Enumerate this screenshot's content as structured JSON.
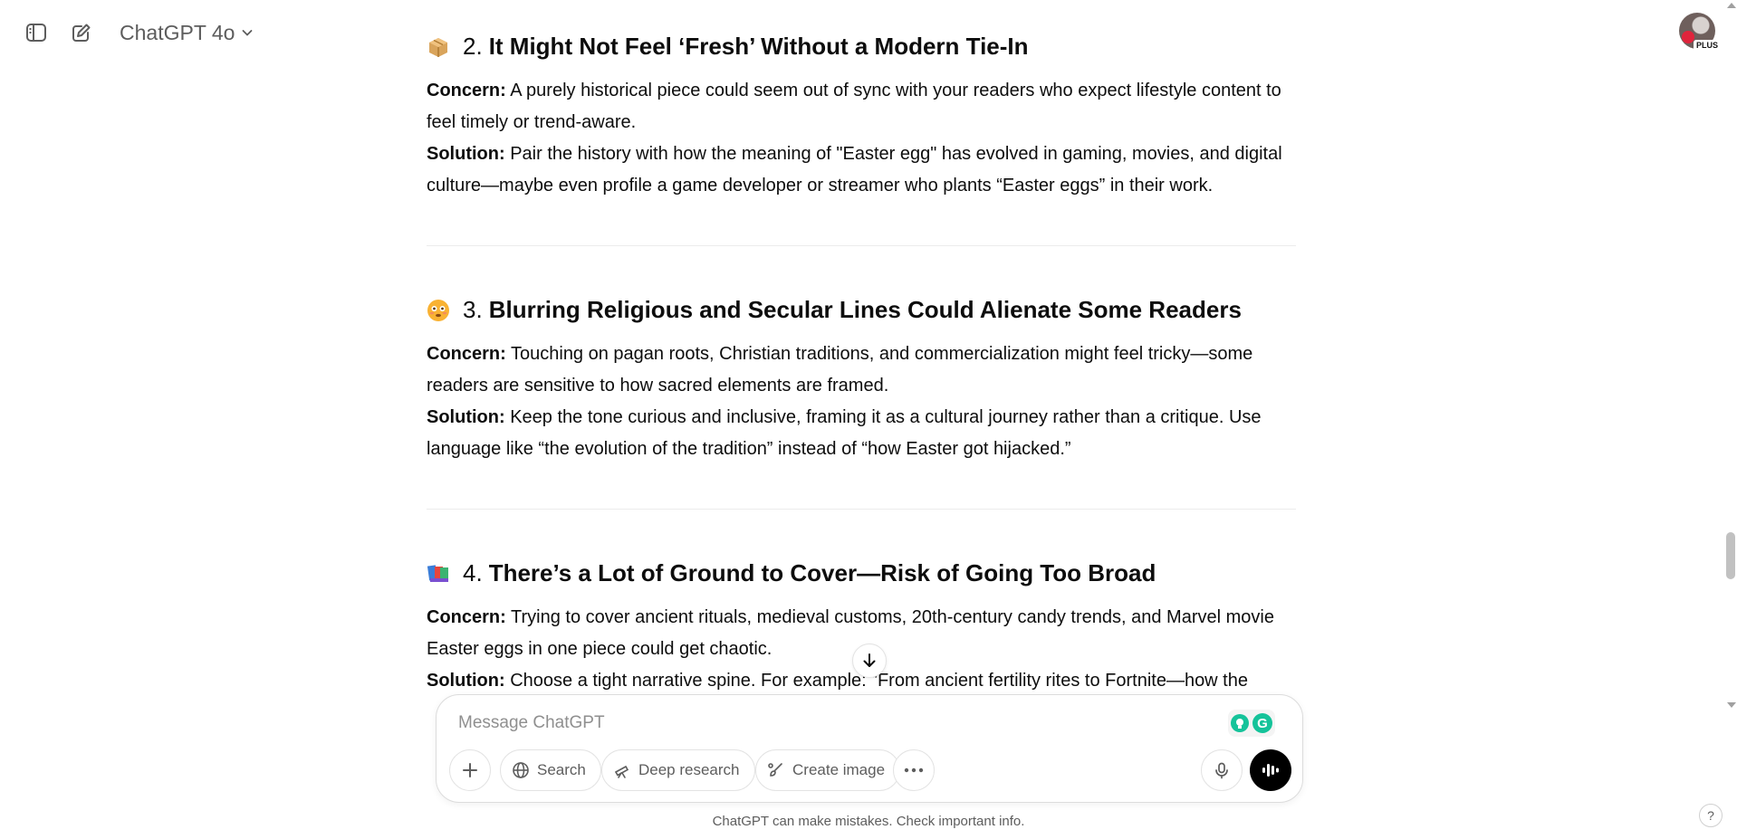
{
  "header": {
    "model_label": "ChatGPT 4o",
    "plan_badge": "PLUS"
  },
  "sections": [
    {
      "emoji": "package-icon",
      "number": "2.",
      "title": "It Might Not Feel ‘Fresh’ Without a Modern Tie-In",
      "concern_label": "Concern:",
      "concern": "A purely historical piece could seem out of sync with your readers who expect lifestyle content to feel timely or trend-aware.",
      "solution_label": "Solution:",
      "solution": "Pair the history with how the meaning of \"Easter egg\" has evolved in gaming, movies, and digital culture—maybe even profile a game developer or streamer who plants “Easter eggs” in their work."
    },
    {
      "emoji": "flushed-face-icon",
      "number": "3.",
      "title": "Blurring Religious and Secular Lines Could Alienate Some Readers",
      "concern_label": "Concern:",
      "concern": "Touching on pagan roots, Christian traditions, and commercialization might feel tricky—some readers are sensitive to how sacred elements are framed.",
      "solution_label": "Solution:",
      "solution": "Keep the tone curious and inclusive, framing it as a cultural journey rather than a critique. Use language like “the evolution of the tradition” instead of “how Easter got hijacked.”"
    },
    {
      "emoji": "books-icon",
      "number": "4.",
      "title": "There’s a Lot of Ground to Cover—Risk of Going Too Broad",
      "concern_label": "Concern:",
      "concern": "Trying to cover ancient rituals, medieval customs, 20th-century candy trends, and Marvel movie Easter eggs in one piece could get chaotic.",
      "solution_label": "Solution:",
      "solution": "Choose a tight narrative spine. For example: “From ancient fertility rites to Fortnite—how the Easter egg became a global symbol of surprise.”"
    }
  ],
  "composer": {
    "placeholder": "Message ChatGPT",
    "search_label": "Search",
    "deep_research_label": "Deep research",
    "create_image_label": "Create image"
  },
  "footer": {
    "disclaimer": "ChatGPT can make mistakes. Check important info.",
    "help_label": "?"
  },
  "colors": {
    "accent_green": "#15c39a",
    "text_primary": "#0d0d0d",
    "text_secondary": "#5d5d5d"
  }
}
